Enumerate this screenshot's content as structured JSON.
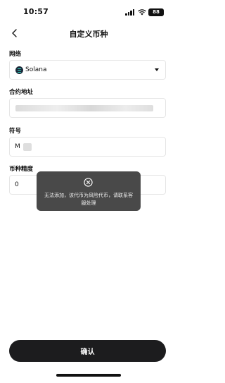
{
  "status_bar": {
    "time": "10:57",
    "battery": "88"
  },
  "nav": {
    "title": "自定义币种"
  },
  "form": {
    "network": {
      "label": "网络",
      "value": "Solana"
    },
    "contract": {
      "label": "合约地址"
    },
    "symbol": {
      "label": "符号",
      "value": "M"
    },
    "precision": {
      "label": "币种精度",
      "value": "0"
    }
  },
  "toast": {
    "icon": "close-circle-icon",
    "message": "无法添加，该代币为风险代币，请联系客服处理"
  },
  "confirm": {
    "label": "确认"
  },
  "colors": {
    "button": "#1c1c1e",
    "toast_bg": "#3a3a3a",
    "solana_accent": "#37d6c4"
  }
}
